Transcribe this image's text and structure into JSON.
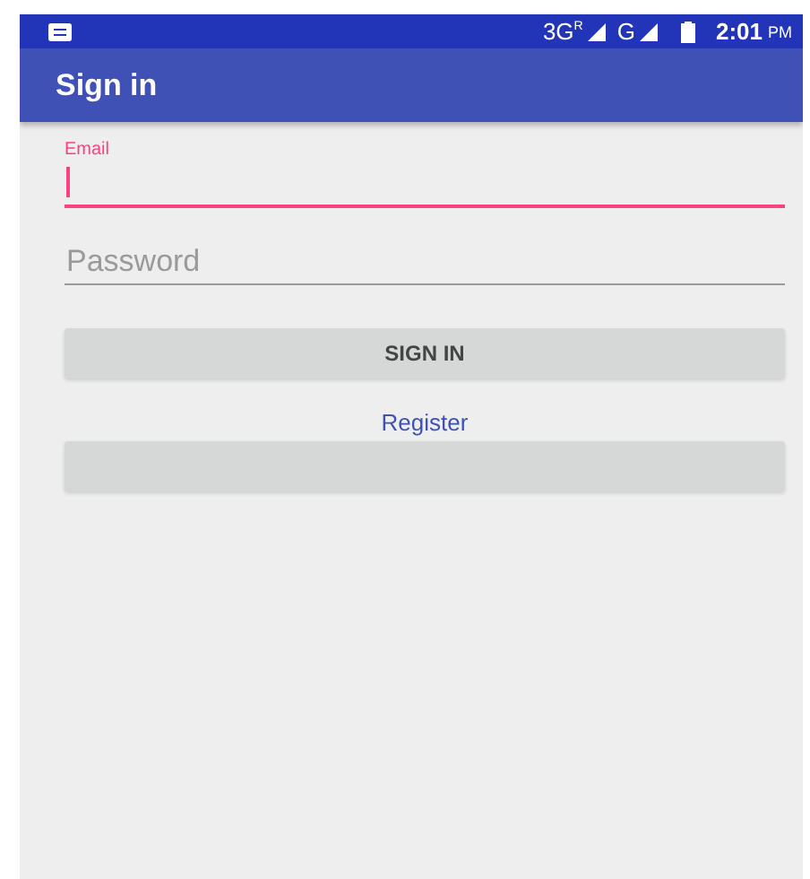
{
  "status_bar": {
    "network_1": "3G",
    "roaming": "R",
    "network_2": "G",
    "time": "2:01",
    "period": "PM"
  },
  "app_bar": {
    "title": "Sign in"
  },
  "email": {
    "label": "Email",
    "focused": true
  },
  "password": {
    "placeholder": "Password",
    "focused": false
  },
  "buttons": [
    {
      "label": "SIGN IN",
      "kind": "button"
    },
    {
      "label": "Register",
      "kind": "link"
    },
    {
      "kind": "button"
    }
  ]
}
